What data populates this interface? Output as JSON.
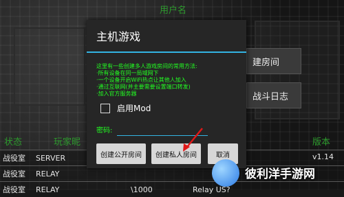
{
  "background": {
    "username_label": "用户名",
    "right_buttons": [
      "建房间",
      "战斗日志"
    ],
    "col_status": "状态",
    "col_player": "玩家昵",
    "col_version": "版本",
    "rows": [
      [
        "战役室",
        "SERVER",
        "",
        ""
      ],
      [
        "战役室",
        "RELAY",
        "",
        ""
      ],
      [
        "战役室",
        "RELAY",
        "\\1000",
        "Relay US?"
      ]
    ],
    "right_partial": "v1.14"
  },
  "dialog": {
    "title": "主机游戏",
    "description": "这里有一些创建多人游戏房间的常用方法:\n·所有设备在同一局域网下\n·一个设备开启WiFi热点让其他人加入\n·通过互联网(并主要需要设置端口转发)\n·加入官方服务器",
    "mod_label": "启用Mod",
    "password_label": "密码:",
    "password_value": "",
    "buttons": {
      "public": "创建公开房间",
      "private": "创建私人房间",
      "cancel": "取消"
    }
  },
  "watermark": {
    "text": "彼利洋手游网"
  }
}
